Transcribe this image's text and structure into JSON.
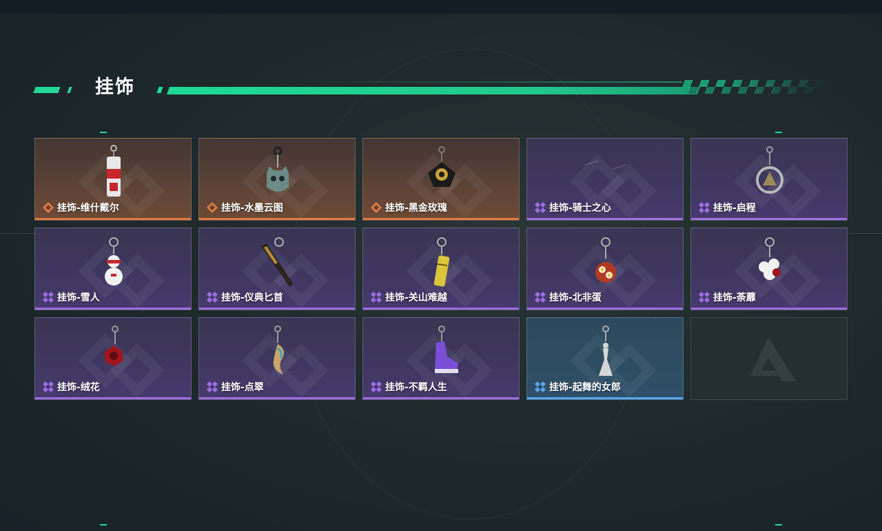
{
  "section": {
    "title": "挂饰"
  },
  "colors": {
    "accent": "#24d796",
    "rarity_orange": "#e07a3e",
    "rarity_purple": "#9b6ee0",
    "rarity_blue": "#5aa3e6"
  },
  "items": [
    {
      "label": "挂饰-维什戴尔",
      "rarity": "orange",
      "icon": "bottle-charm-icon"
    },
    {
      "label": "挂饰-水墨云图",
      "rarity": "orange",
      "icon": "cat-charm-icon"
    },
    {
      "label": "挂饰-黑金玫瑰",
      "rarity": "orange",
      "icon": "rose-charm-icon"
    },
    {
      "label": "挂饰-骑士之心",
      "rarity": "purple",
      "icon": "knight-heart-charm-icon"
    },
    {
      "label": "挂饰-启程",
      "rarity": "purple",
      "icon": "emblem-charm-icon"
    },
    {
      "label": "挂饰-雪人",
      "rarity": "purple",
      "icon": "snowman-charm-icon"
    },
    {
      "label": "挂饰-仪典匕首",
      "rarity": "purple",
      "icon": "dagger-charm-icon"
    },
    {
      "label": "挂饰-关山难越",
      "rarity": "purple",
      "icon": "canister-charm-icon"
    },
    {
      "label": "挂饰-北非蛋",
      "rarity": "purple",
      "icon": "shakshuka-charm-icon"
    },
    {
      "label": "挂饰-荼蘼",
      "rarity": "purple",
      "icon": "flower-charm-icon"
    },
    {
      "label": "挂饰-绒花",
      "rarity": "purple",
      "icon": "velvet-flower-charm-icon"
    },
    {
      "label": "挂饰-点翠",
      "rarity": "purple",
      "icon": "kingfisher-charm-icon"
    },
    {
      "label": "挂饰-不羁人生",
      "rarity": "purple",
      "icon": "sneaker-charm-icon"
    },
    {
      "label": "挂饰-起舞的女郎",
      "rarity": "blue",
      "icon": "dancer-charm-icon"
    }
  ]
}
